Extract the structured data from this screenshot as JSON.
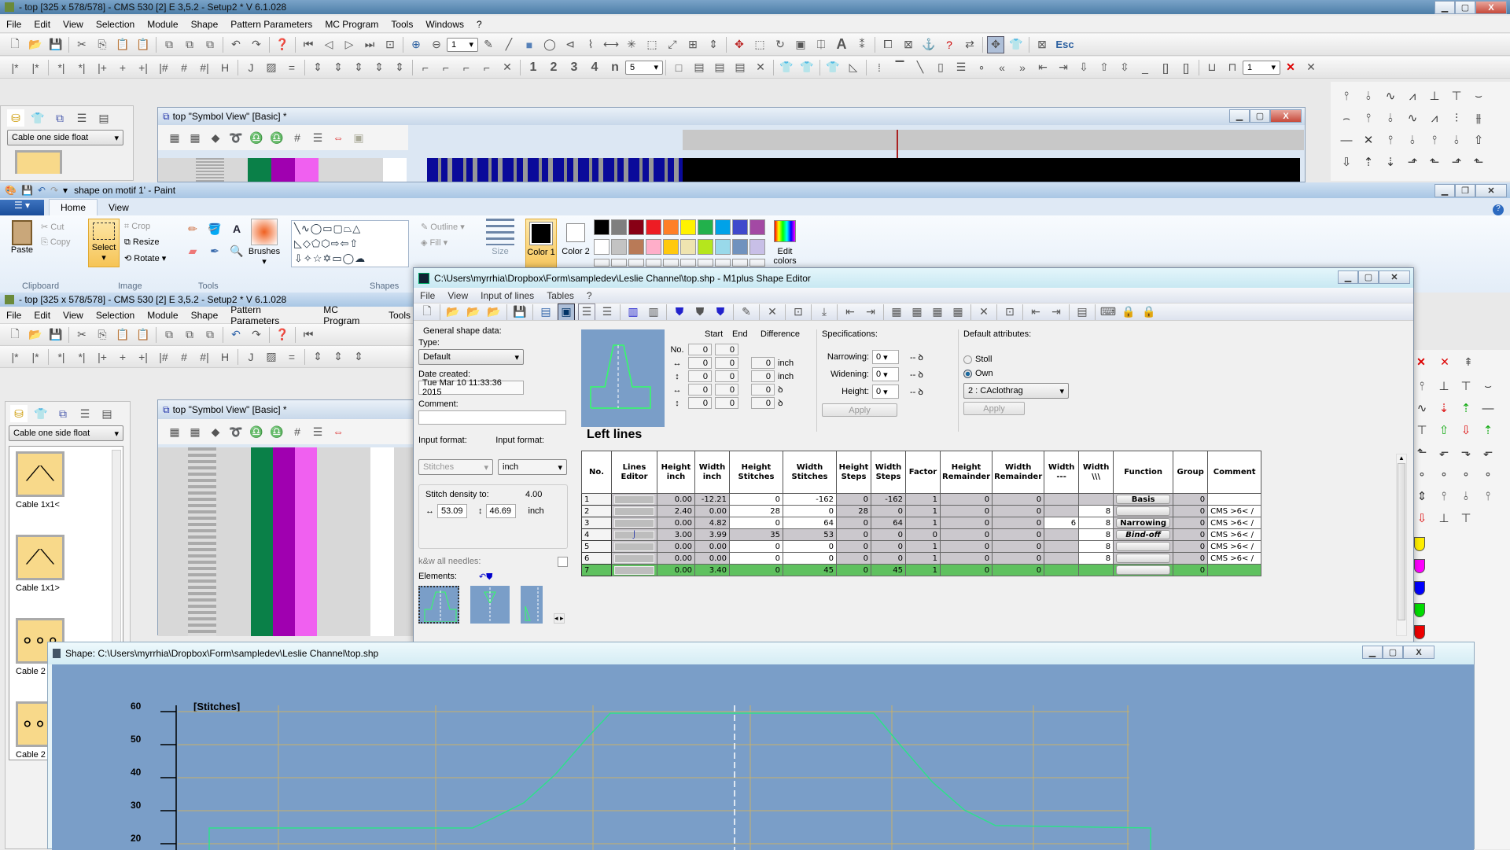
{
  "cms_back": {
    "title": "- top [325 x 578/578] - CMS 530 [2] E 3,5.2 - Setup2 *    V 6.1.028",
    "menu": [
      "File",
      "Edit",
      "View",
      "Selection",
      "Module",
      "Shape",
      "Pattern Parameters",
      "MC Program",
      "Tools",
      "Windows",
      "?"
    ],
    "zoom_value": "1",
    "repeat_value": "5",
    "right_combo_value": "1",
    "esc_label": "Esc",
    "number_buttons": [
      "1",
      "2",
      "3",
      "4",
      "n"
    ],
    "library_combo": "Cable one side float",
    "symbol_view_title": "top \"Symbol View\" [Basic] *"
  },
  "paint": {
    "title": "shape on motif 1' - Paint",
    "tabs": [
      "Home",
      "View"
    ],
    "clipboard": {
      "paste": "Paste",
      "cut": "Cut",
      "copy": "Copy",
      "group": "Clipboard"
    },
    "image": {
      "select": "Select",
      "crop": "Crop",
      "resize": "Resize",
      "rotate": "Rotate",
      "group": "Image"
    },
    "tools_group": "Tools",
    "brushes": "Brushes",
    "shapes_group": "Shapes",
    "outline": "Outline",
    "fill": "Fill",
    "size": "Size",
    "color1": "Color 1",
    "color2": "Color 2",
    "edit_colors": "Edit colors",
    "palette_row1": [
      "#000000",
      "#7f7f7f",
      "#880015",
      "#ed1c24",
      "#ff7f27",
      "#fff200",
      "#22b14c",
      "#00a2e8",
      "#3f48cc",
      "#a349a4"
    ],
    "palette_row2": [
      "#ffffff",
      "#c3c3c3",
      "#b97a57",
      "#ffaec9",
      "#ffc90e",
      "#efe4b0",
      "#b5e61d",
      "#99d9ea",
      "#7092be",
      "#c8bfe7"
    ]
  },
  "cms_front": {
    "title": "- top [325 x 578/578] - CMS 530 [2] E 3,5.2 - Setup2 *    V 6.1.028",
    "menu": [
      "File",
      "Edit",
      "View",
      "Selection",
      "Module",
      "Shape",
      "Pattern Parameters",
      "MC Program",
      "Tools"
    ],
    "library_combo": "Cable one side float",
    "library_items": [
      "Cable 1x1<",
      "Cable 1x1>",
      "Cable 2",
      "Cable 2"
    ],
    "symbol_view_title": "top \"Symbol View\" [Basic] *"
  },
  "shape_editor": {
    "title": "C:\\Users\\myrrhia\\Dropbox\\Form\\sampledev\\Leslie Channel\\top.shp - M1plus Shape Editor",
    "menu": [
      "File",
      "View",
      "Input of lines",
      "Tables",
      "?"
    ],
    "general": {
      "group_label": "General shape data:",
      "type_label": "Type:",
      "type_value": "Default",
      "date_label": "Date created:",
      "date_value": "Tue Mar 10 11:33:36 2015",
      "comment_label": "Comment:",
      "comment_value": "",
      "input_format_label1": "Input format:",
      "input_format_label2": "Input format:",
      "format1": "Stitches",
      "format2": "inch",
      "density_label": "Stitch density to:",
      "density_value": "4.00",
      "density_h": "53.09",
      "density_v": "46.69",
      "density_unit": "inch",
      "kw_label": "k&w all needles:",
      "elements_label": "Elements:"
    },
    "coords": {
      "start_label": "Start",
      "end_label": "End",
      "diff_label": "Difference",
      "no_label": "No.",
      "rows": [
        {
          "start": "0",
          "end": "0",
          "diff": null,
          "unit": ""
        },
        {
          "start": "0",
          "end": "0",
          "diff": "0",
          "unit": "inch"
        },
        {
          "start": "0",
          "end": "0",
          "diff": "0",
          "unit": "inch"
        },
        {
          "start": "0",
          "end": "0",
          "diff": "0",
          "unit": "ꝺ"
        },
        {
          "start": "0",
          "end": "0",
          "diff": "0",
          "unit": "ꝺ"
        }
      ]
    },
    "specs": {
      "label": "Specifications:",
      "narrowing_label": "Narrowing:",
      "narrowing": "0",
      "widening_label": "Widening:",
      "widening": "0",
      "height_label": "Height:",
      "height": "0",
      "apply": "Apply"
    },
    "defaults": {
      "label": "Default attributes:",
      "stoll": "Stoll",
      "own": "Own",
      "selected": "Own",
      "combo": "2 : CAclothrag",
      "apply": "Apply"
    },
    "section_title": "Left lines",
    "table": {
      "headers": [
        "No.",
        "Lines Editor",
        "Height inch",
        "Width inch",
        "Height Stitches",
        "Width Stitches",
        "Height Steps",
        "Width Steps",
        "Factor",
        "Height Remainder",
        "Width Remainder",
        "Width ---",
        "Width \\\\\\",
        "Function",
        "Group",
        "Comment"
      ],
      "rows": [
        {
          "no": "1",
          "h_in": "0.00",
          "w_in": "-12.21",
          "h_st": "0",
          "w_st": "-162",
          "h_steps": "0",
          "w_steps": "-162",
          "factor": "1",
          "h_rem": "0",
          "w_rem": "0",
          "w_dash": "",
          "w_bs": "",
          "function": "Basis",
          "group": "0",
          "comment": ""
        },
        {
          "no": "2",
          "h_in": "2.40",
          "w_in": "0.00",
          "h_st": "28",
          "w_st": "0",
          "h_steps": "28",
          "w_steps": "0",
          "factor": "1",
          "h_rem": "0",
          "w_rem": "0",
          "w_dash": "",
          "w_bs": "8",
          "function": "",
          "group": "0",
          "comment": "CMS  >6< /"
        },
        {
          "no": "3",
          "h_in": "0.00",
          "w_in": "4.82",
          "h_st": "0",
          "w_st": "64",
          "h_steps": "0",
          "w_steps": "64",
          "factor": "1",
          "h_rem": "0",
          "w_rem": "0",
          "w_dash": "6",
          "w_bs": "8",
          "function": "Narrowing",
          "group": "0",
          "comment": "CMS  >6< /"
        },
        {
          "no": "4",
          "h_in": "3.00",
          "w_in": "3.99",
          "h_st": "35",
          "w_st": "53",
          "h_steps": "0",
          "w_steps": "0",
          "factor": "0",
          "h_rem": "0",
          "w_rem": "0",
          "w_dash": "",
          "w_bs": "8",
          "function": "Bind-off",
          "group": "0",
          "comment": "CMS  >6< /"
        },
        {
          "no": "5",
          "h_in": "0.00",
          "w_in": "0.00",
          "h_st": "0",
          "w_st": "0",
          "h_steps": "0",
          "w_steps": "0",
          "factor": "1",
          "h_rem": "0",
          "w_rem": "0",
          "w_dash": "",
          "w_bs": "8",
          "function": "",
          "group": "0",
          "comment": "CMS  >6< /"
        },
        {
          "no": "6",
          "h_in": "0.00",
          "w_in": "0.00",
          "h_st": "0",
          "w_st": "0",
          "h_steps": "0",
          "w_steps": "0",
          "factor": "1",
          "h_rem": "0",
          "w_rem": "0",
          "w_dash": "",
          "w_bs": "8",
          "function": "",
          "group": "0",
          "comment": "CMS  >6< /"
        },
        {
          "no": "7",
          "h_in": "0.00",
          "w_in": "3.40",
          "h_st": "0",
          "w_st": "45",
          "h_steps": "0",
          "w_steps": "45",
          "factor": "1",
          "h_rem": "0",
          "w_rem": "0",
          "w_dash": "",
          "w_bs": "",
          "function": "",
          "group": "0",
          "comment": ""
        }
      ]
    }
  },
  "shape_view": {
    "title": "Shape: C:\\Users\\myrrhia\\Dropbox\\Form\\sampledev\\Leslie Channel\\top.shp",
    "y_unit": "[Stitches]",
    "y_ticks": [
      "60",
      "50",
      "40",
      "30",
      "20"
    ]
  }
}
